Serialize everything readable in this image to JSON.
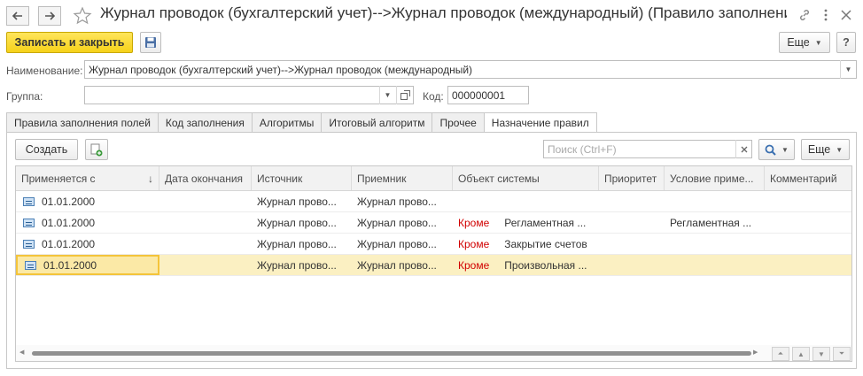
{
  "window": {
    "title": "Журнал проводок (бухгалтерский учет)-->Журнал проводок (международный) (Правило заполнени..."
  },
  "toolbar": {
    "save_close_label": "Записать и закрыть",
    "more_label": "Еще"
  },
  "form": {
    "name_label": "Наименование:",
    "name_value": "Журнал проводок (бухгалтерский учет)-->Журнал проводок (международный)",
    "group_label": "Группа:",
    "group_value": "",
    "code_label": "Код:",
    "code_value": "000000001"
  },
  "tabs": [
    {
      "label": "Правила заполнения полей",
      "active": false
    },
    {
      "label": "Код заполнения",
      "active": false
    },
    {
      "label": "Алгоритмы",
      "active": false
    },
    {
      "label": "Итоговый алгоритм",
      "active": false
    },
    {
      "label": "Прочее",
      "active": false
    },
    {
      "label": "Назначение правил",
      "active": true
    }
  ],
  "list_toolbar": {
    "create_label": "Создать",
    "search_placeholder": "Поиск (Ctrl+F)",
    "more_label": "Еще"
  },
  "table": {
    "columns": [
      "Применяется с",
      "Дата окончания",
      "Источник",
      "Приемник",
      "Объект системы",
      "Приоритет",
      "Условие приме...",
      "Комментарий"
    ],
    "sort_indicator": "↓",
    "rows": [
      {
        "date": "01.01.2000",
        "end": "",
        "source": "Журнал прово...",
        "target": "Журнал прово...",
        "except": "",
        "object": "",
        "priority": "",
        "condition": "",
        "comment": ""
      },
      {
        "date": "01.01.2000",
        "end": "",
        "source": "Журнал прово...",
        "target": "Журнал прово...",
        "except": "Кроме",
        "object": "Регламентная ...",
        "priority": "",
        "condition": "Регламентная ...",
        "comment": ""
      },
      {
        "date": "01.01.2000",
        "end": "",
        "source": "Журнал прово...",
        "target": "Журнал прово...",
        "except": "Кроме",
        "object": "Закрытие счетов",
        "priority": "",
        "condition": "",
        "comment": ""
      },
      {
        "date": "01.01.2000",
        "end": "",
        "source": "Журнал прово...",
        "target": "Журнал прово...",
        "except": "Кроме",
        "object": "Произвольная ...",
        "priority": "",
        "condition": "",
        "comment": ""
      }
    ]
  },
  "colors": {
    "accent": "#f6d21a",
    "selected_row": "#fbf0c2",
    "except_text": "#d10000"
  }
}
